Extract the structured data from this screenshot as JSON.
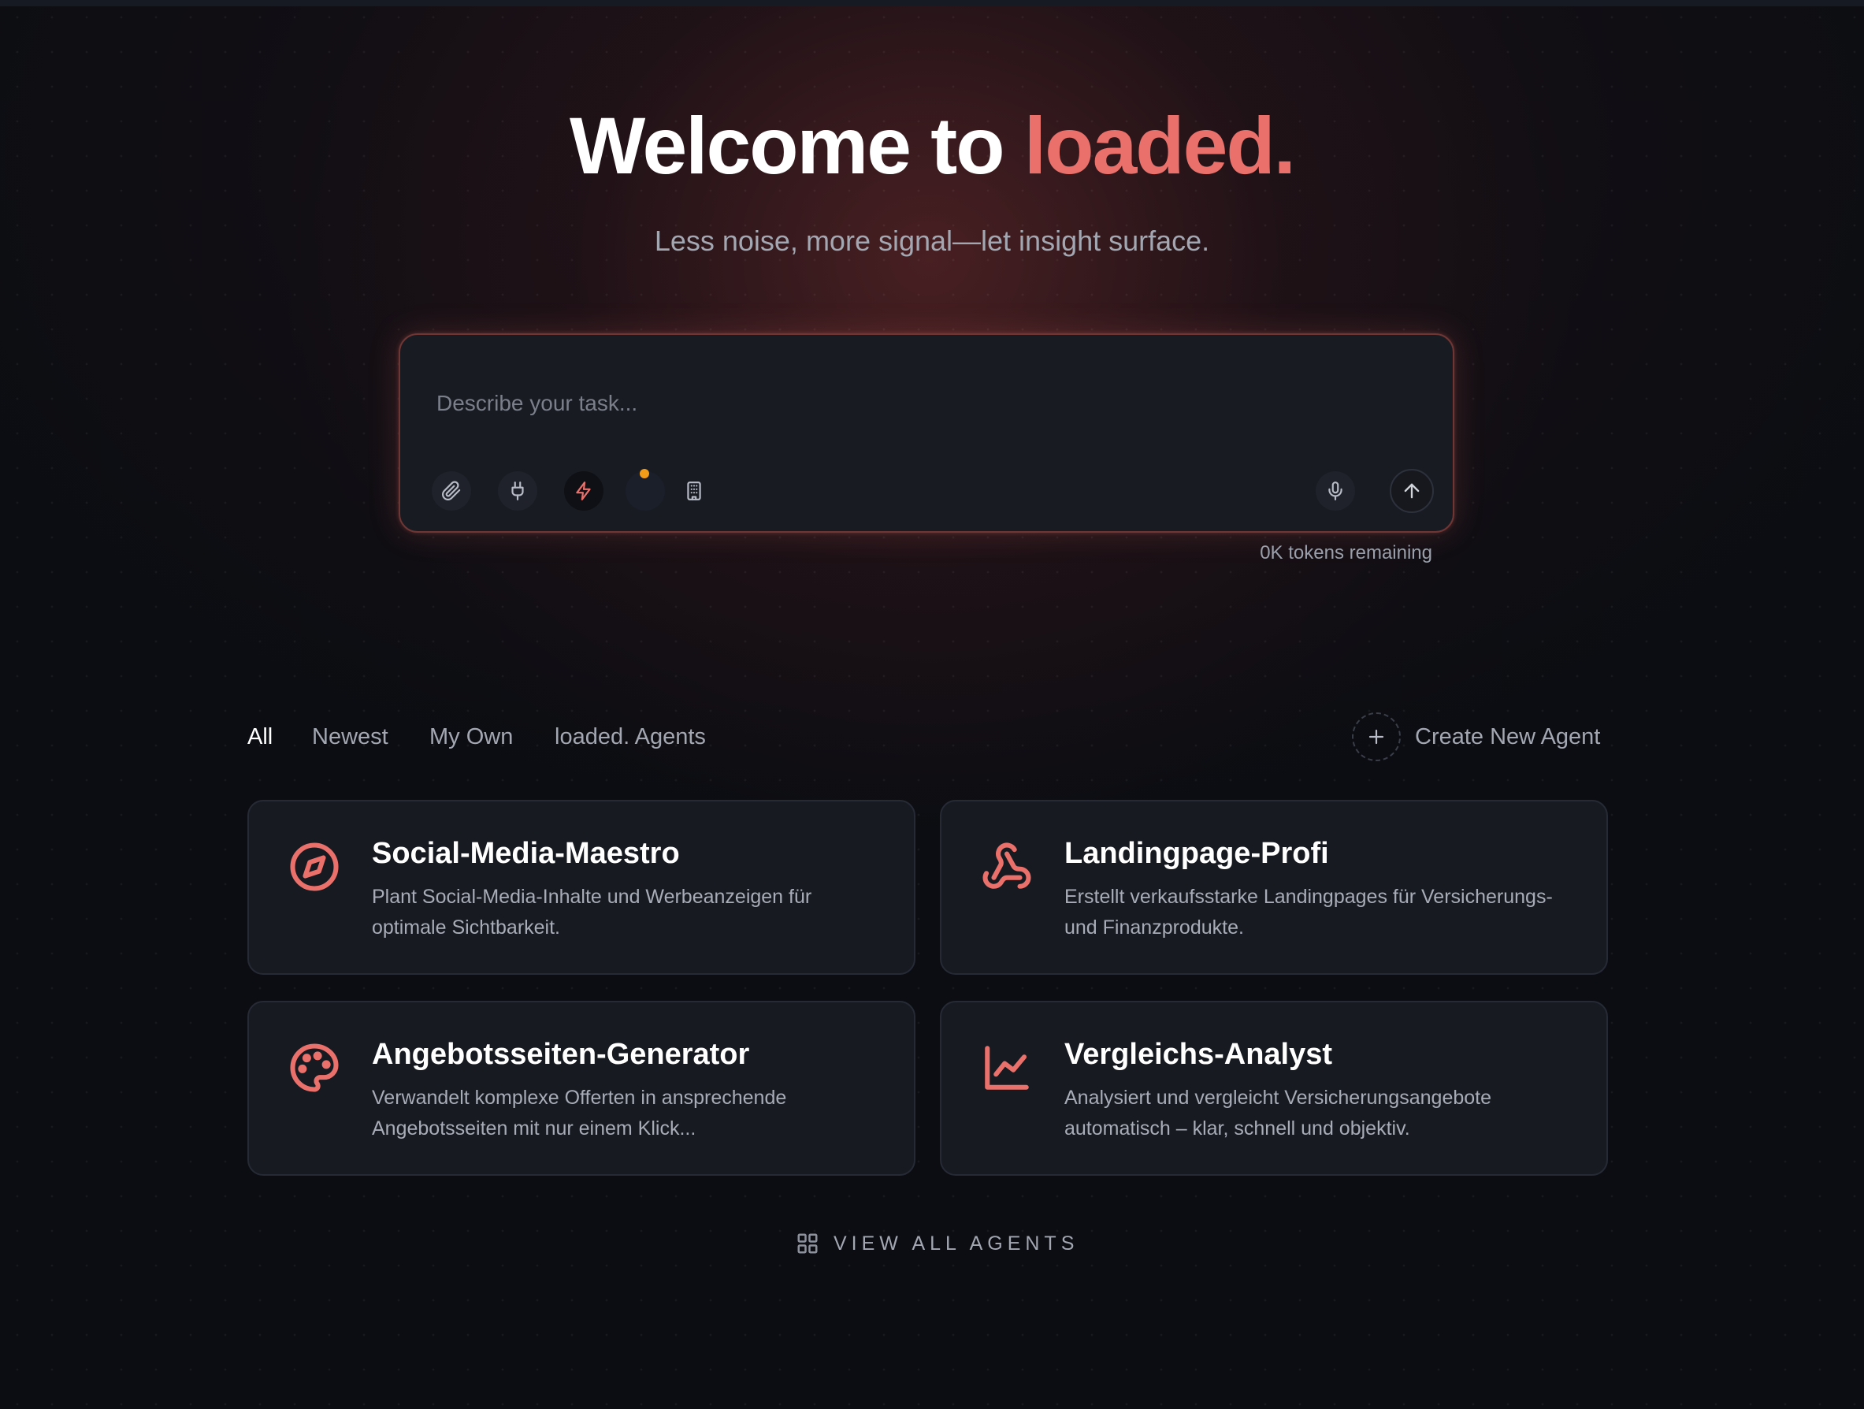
{
  "hero": {
    "title_prefix": "Welcome to ",
    "title_brand": "loaded.",
    "subtitle": "Less noise, more signal—let insight surface."
  },
  "composer": {
    "placeholder": "Describe your task...",
    "value": "",
    "tokens_remaining": "0K tokens remaining",
    "tools": [
      "paperclip-icon",
      "plug-icon",
      "bolt-icon",
      "building-icon",
      "microphone-icon",
      "arrow-up-icon"
    ]
  },
  "filters": {
    "tabs": [
      {
        "label": "All",
        "active": true
      },
      {
        "label": "Newest",
        "active": false
      },
      {
        "label": "My Own",
        "active": false
      },
      {
        "label": "loaded. Agents",
        "active": false
      }
    ],
    "create_label": "Create New Agent"
  },
  "agents": [
    {
      "title": "Social-Media-Maestro",
      "description": "Plant Social-Media-Inhalte und Werbeanzeigen für optimale Sichtbarkeit.",
      "icon": "compass-icon"
    },
    {
      "title": "Landingpage-Profi",
      "description": "Erstellt verkaufsstarke Landingpages für Versicherungs- und Finanzprodukte.",
      "icon": "webhook-icon"
    },
    {
      "title": "Angebotsseiten-Generator",
      "description": "Verwandelt komplexe Offerten in ansprechende Angebotsseiten mit nur einem Klick...",
      "icon": "palette-icon"
    },
    {
      "title": "Vergleichs-Analyst",
      "description": "Analysiert und vergleicht Versicherungsangebote automatisch – klar, schnell und objektiv.",
      "icon": "line-chart-icon"
    }
  ],
  "view_all_label": "VIEW ALL AGENTS",
  "colors": {
    "accent": "#ea716b",
    "background": "#0b0d12",
    "card": "#171a21",
    "status_dot": "#f39c1a"
  }
}
